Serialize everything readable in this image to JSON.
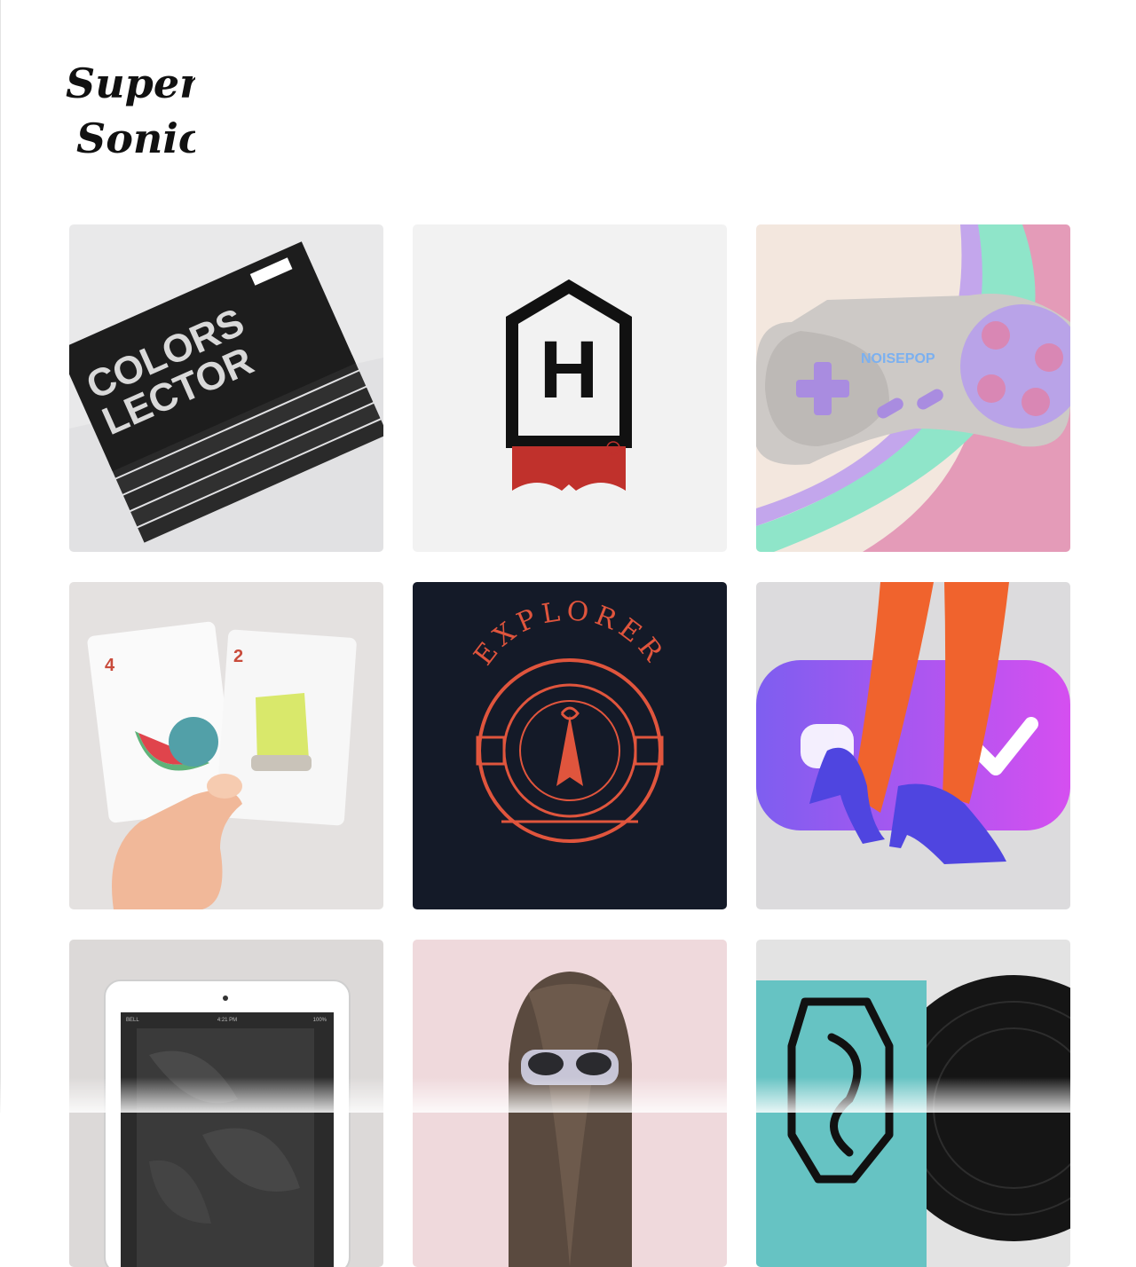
{
  "brand": {
    "logo_line1": "Super",
    "logo_line2": "Sonic",
    "color": "#111111"
  },
  "portfolio": {
    "items": [
      {
        "id": "colors-lector",
        "kind": "book-stack",
        "title_line1": "COLORS",
        "title_line2": "LECTOR",
        "background": "#e9e9ea"
      },
      {
        "id": "h-logo",
        "kind": "house-logo",
        "letter": "H",
        "background": "#f2f2f2",
        "accent": "#c0312c"
      },
      {
        "id": "noisepop",
        "kind": "game-controller",
        "brand_text": "NOISEPOP",
        "background": "#f3e7de",
        "accent": "#b39ae6"
      },
      {
        "id": "playing-cards",
        "kind": "cards",
        "card1_rank": "4",
        "card2_rank": "2",
        "background": "#e4e1e0"
      },
      {
        "id": "explorer",
        "kind": "badge",
        "title": "EXPLORER",
        "background": "#141a28",
        "accent": "#e0553d"
      },
      {
        "id": "stiletto",
        "kind": "legs",
        "background": "#dcdbdd",
        "accent": "#f0632d"
      },
      {
        "id": "tablet",
        "kind": "tablet",
        "status_carrier": "BELL",
        "status_time": "4:21 PM",
        "status_battery": "100%",
        "background": "#dcd9d8"
      },
      {
        "id": "sunglasses",
        "kind": "portrait",
        "background": "#efd9dc"
      },
      {
        "id": "vinyl",
        "kind": "record",
        "background": "#e3e3e3",
        "accent": "#66c3c3"
      }
    ]
  }
}
